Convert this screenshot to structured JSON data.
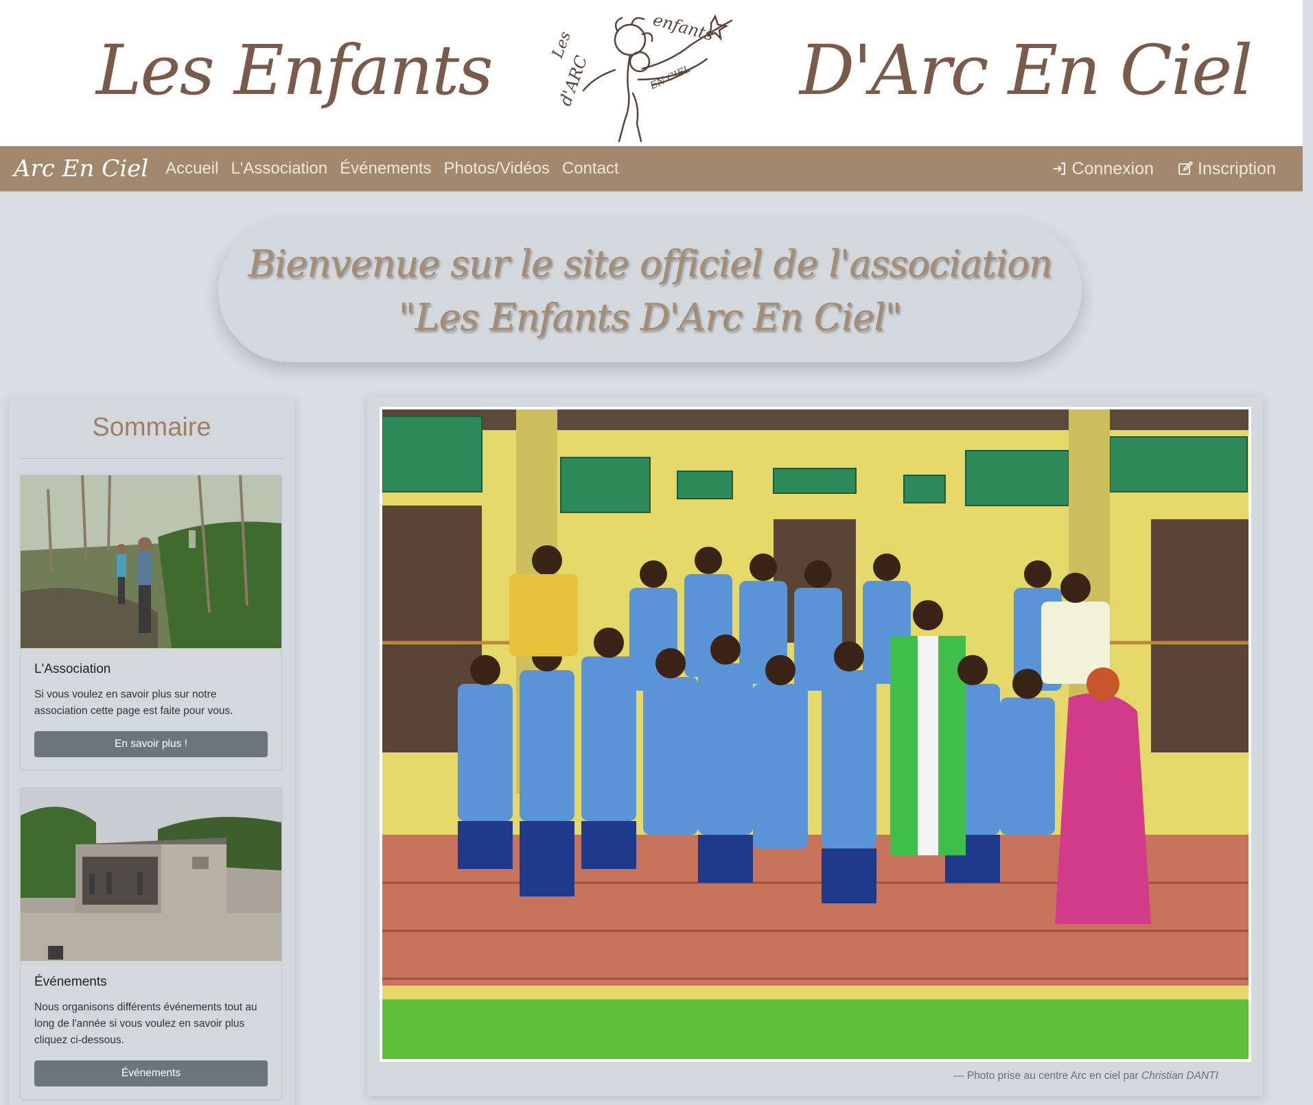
{
  "header": {
    "title_left": "Les Enfants",
    "title_right": "D'Arc En Ciel"
  },
  "navbar": {
    "brand": "Arc En Ciel",
    "links": [
      "Accueil",
      "L'Association",
      "Événements",
      "Photos/Vidéos",
      "Contact"
    ],
    "login": "Connexion",
    "signup": "Inscription"
  },
  "welcome": {
    "line1": "Bienvenue sur le site officiel de l'association",
    "line2": "\"Les Enfants D'Arc En Ciel\""
  },
  "sidebar": {
    "title": "Sommaire",
    "cards": [
      {
        "title": "L'Association",
        "text": "Si vous voulez en savoir plus sur notre association cette page est faite pour vous.",
        "button": "En savoir plus !"
      },
      {
        "title": "Événements",
        "text": "Nous organisons différents événements tout au long de l'année si vous voulez en savoir plus cliquez ci-dessous.",
        "button": "Événements"
      }
    ]
  },
  "photo": {
    "caption_prefix": "— Photo prise au centre Arc en ciel par",
    "caption_author": "Christian DANTI"
  },
  "colors": {
    "brown_title": "#7a5a4a",
    "navbar": "#a2896d",
    "welcome_text": "#a58c74",
    "button": "#6c757d",
    "background": "#d9dee2"
  }
}
